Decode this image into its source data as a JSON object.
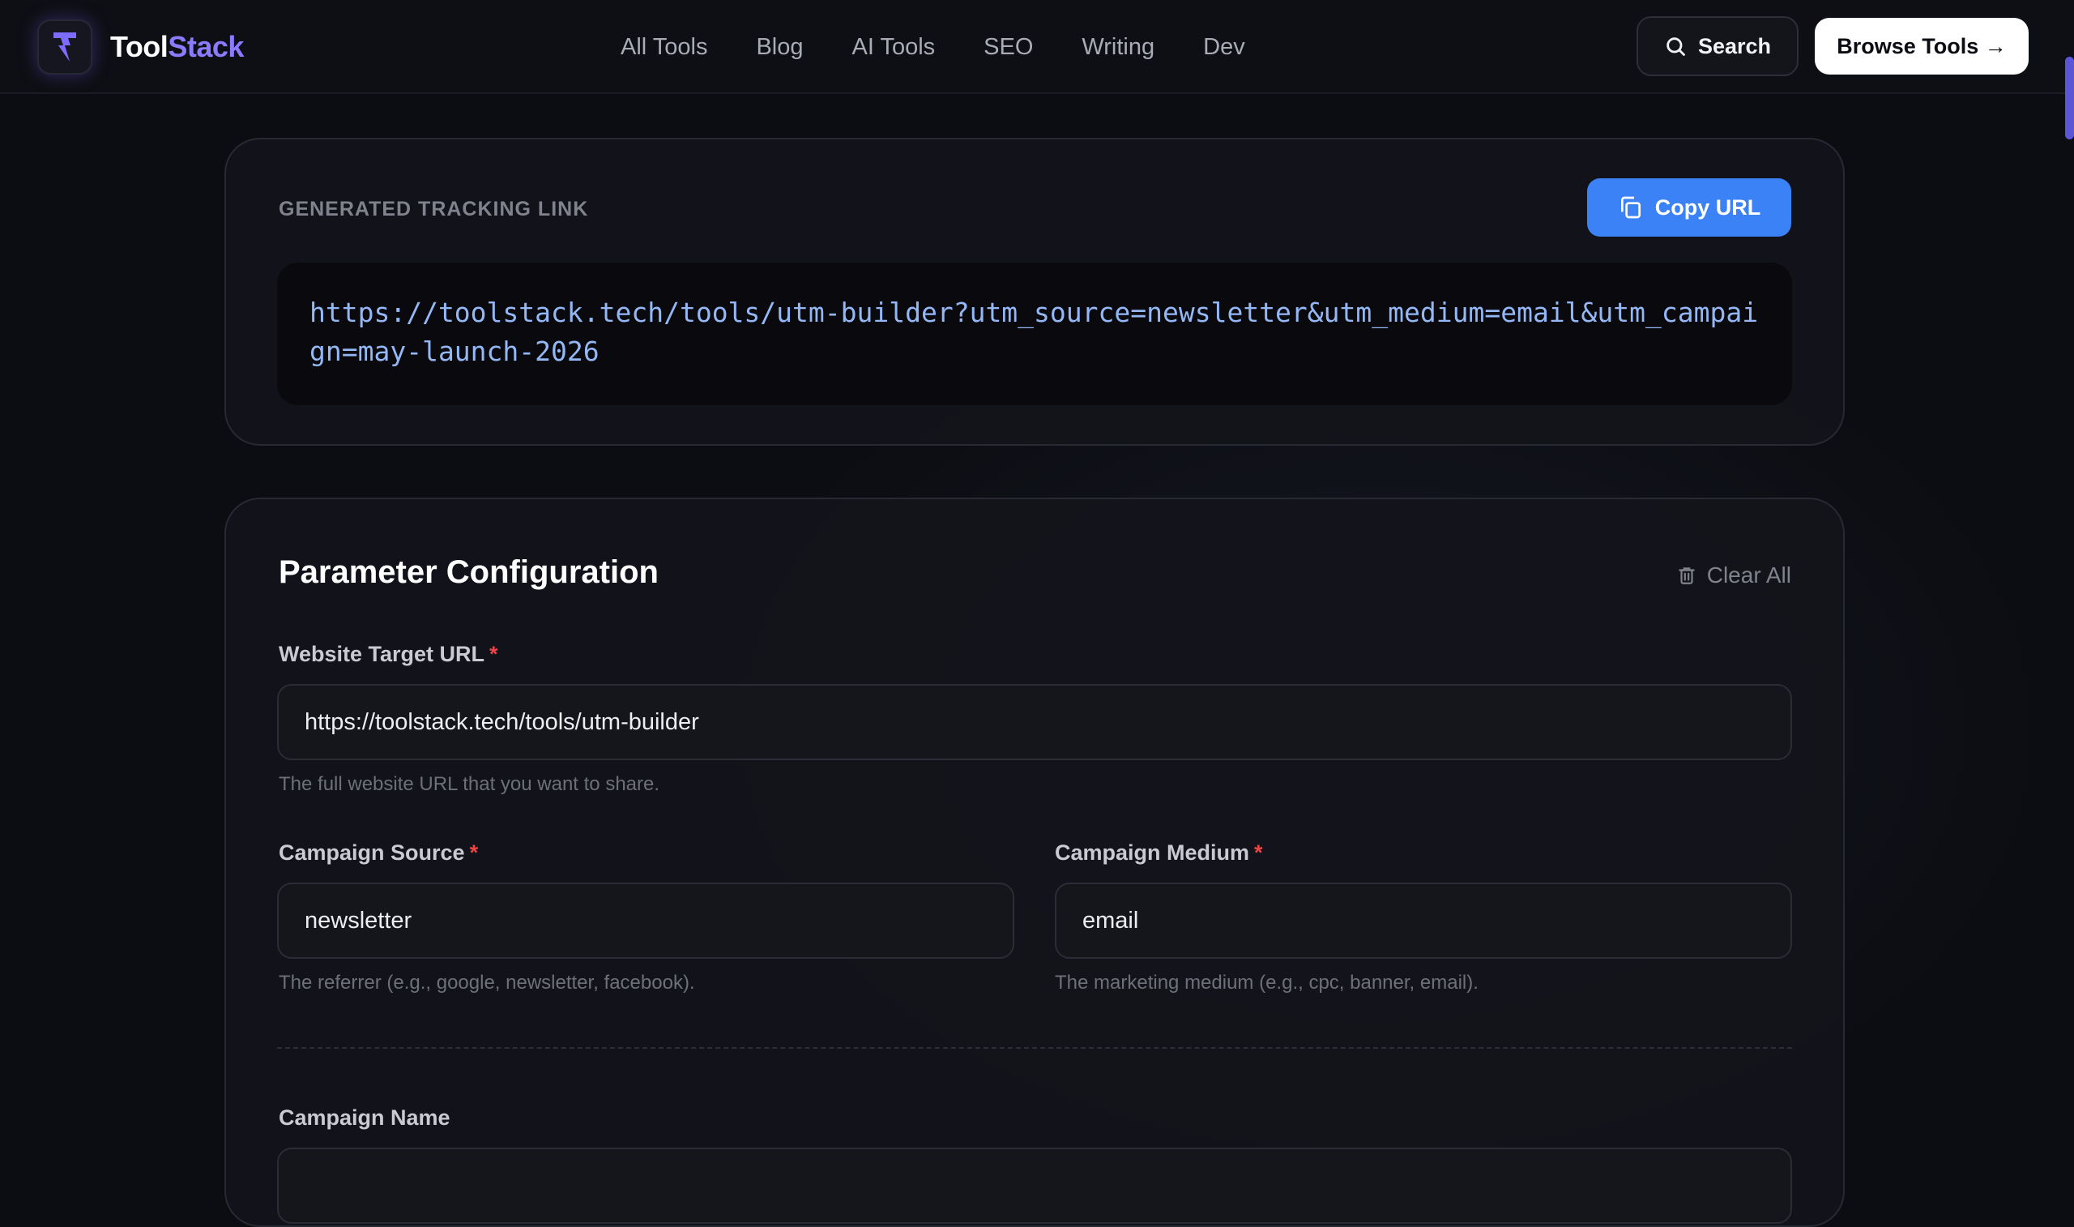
{
  "header": {
    "brand_part1": "Tool",
    "brand_part2": "Stack",
    "nav": [
      "All Tools",
      "Blog",
      "AI Tools",
      "SEO",
      "Writing",
      "Dev"
    ],
    "search_label": "Search",
    "browse_label": "Browse Tools →"
  },
  "link_card": {
    "label": "GENERATED TRACKING LINK",
    "copy_label": "Copy URL",
    "url": "https://toolstack.tech/tools/utm-builder?utm_source=newsletter&utm_medium=email&utm_campaign=may-launch-2026"
  },
  "params": {
    "title": "Parameter Configuration",
    "clear_label": "Clear All",
    "website_url": {
      "label": "Website Target URL",
      "required_mark": "*",
      "value": "https://toolstack.tech/tools/utm-builder",
      "help": "The full website URL that you want to share."
    },
    "source": {
      "label": "Campaign Source",
      "required_mark": "*",
      "value": "newsletter",
      "help": "The referrer (e.g., google, newsletter, facebook)."
    },
    "medium": {
      "label": "Campaign Medium",
      "required_mark": "*",
      "value": "email",
      "help": "The marketing medium (e.g., cpc, banner, email)."
    },
    "campaign_name": {
      "label": "Campaign Name"
    }
  },
  "colors": {
    "accent": "#3b82f6",
    "brand_purple": "#8b7bff",
    "required": "#ef4444"
  }
}
